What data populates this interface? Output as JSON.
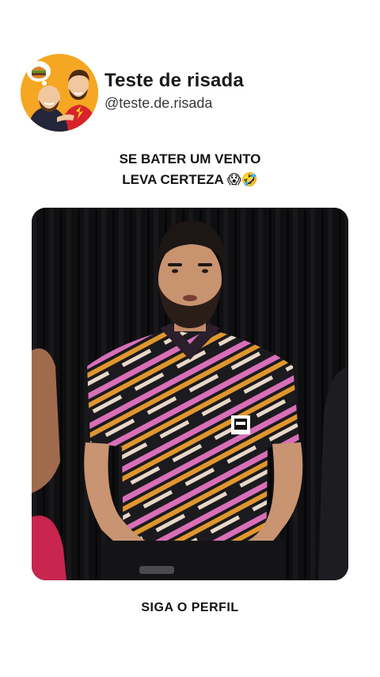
{
  "post": {
    "display_name": "Teste de risada",
    "handle": "@teste.de.risada",
    "avatar_icon": "cartoon-duo-avatar",
    "caption_lines": [
      "SE BATER UM VENTO",
      "LEVA CERTEZA 😱🤣"
    ],
    "call_to_action": "SIGA O PERFIL"
  },
  "video": {
    "description_icon": "video-frame",
    "badge_icon": "mtv-logo-badge"
  },
  "colors": {
    "background": "#ffffff",
    "avatar_bg": "#f5a623",
    "shirt_pink": "#d86fb8",
    "shirt_orange": "#e0962e",
    "curtain": "#0d0d0e"
  }
}
